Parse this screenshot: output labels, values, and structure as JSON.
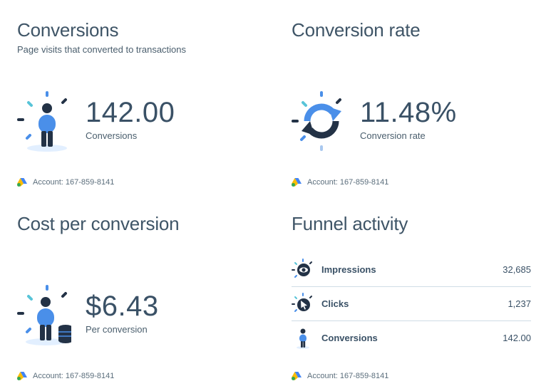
{
  "panels": {
    "conversions": {
      "title": "Conversions",
      "subtitle": "Page visits that converted to transactions",
      "value": "142.00",
      "label": "Conversions",
      "account": "Account: 167-859-8141"
    },
    "conversion_rate": {
      "title": "Conversion rate",
      "value": "11.48%",
      "label": "Conversion rate",
      "account": "Account: 167-859-8141"
    },
    "cost_per_conversion": {
      "title": "Cost per conversion",
      "value": "$6.43",
      "label": "Per conversion",
      "account": "Account: 167-859-8141"
    },
    "funnel": {
      "title": "Funnel activity",
      "rows": [
        {
          "name": "Impressions",
          "value": "32,685",
          "icon": "eye-icon"
        },
        {
          "name": "Clicks",
          "value": "1,237",
          "icon": "cursor-icon"
        },
        {
          "name": "Conversions",
          "value": "142.00",
          "icon": "person-icon"
        }
      ],
      "account": "Account: 167-859-8141"
    }
  },
  "colors": {
    "accent_blue": "#4a8fe9",
    "navy": "#233246",
    "teal": "#58c4d8",
    "text": "#3d5466",
    "divider": "#cfdce6"
  }
}
